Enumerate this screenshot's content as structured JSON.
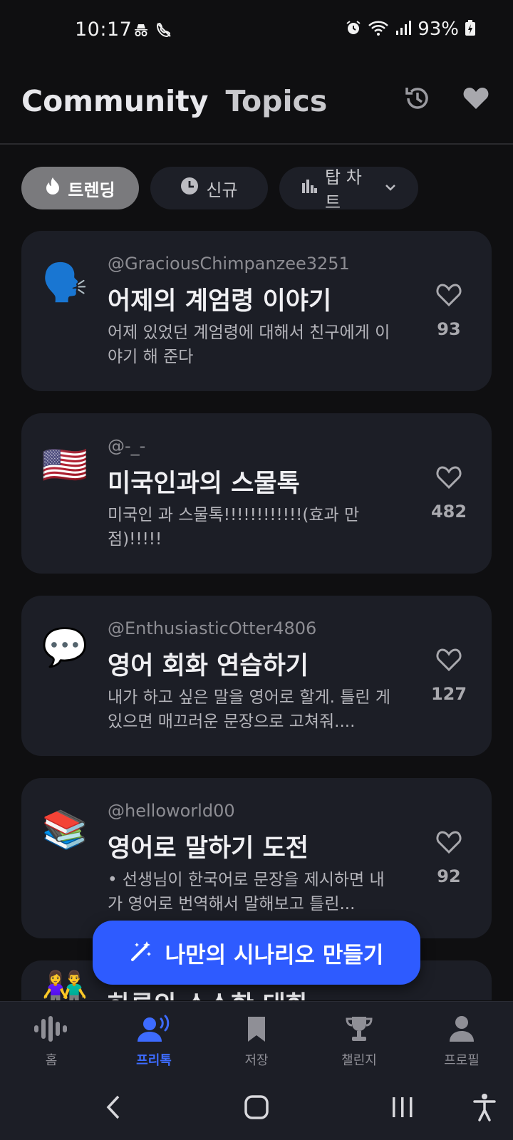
{
  "status_bar": {
    "time": "10:17",
    "battery": "93%",
    "icons": [
      "incognito-icon",
      "no-call-icon",
      "alarm-icon",
      "wifi-icon",
      "signal-icon",
      "battery-icon"
    ]
  },
  "header": {
    "tabs": [
      {
        "label": "Community",
        "active": true
      },
      {
        "label": "Topics",
        "active": false
      }
    ],
    "icons": [
      "history-icon",
      "heart-icon"
    ]
  },
  "filters": [
    {
      "label": "트렌딩",
      "icon": "fire-icon",
      "active": true
    },
    {
      "label": "신규",
      "icon": "clock-icon",
      "active": false
    },
    {
      "label": "탑 차트",
      "icon": "bar-chart-icon",
      "active": false
    }
  ],
  "topics": [
    {
      "emoji": "🗣️",
      "author": "@GraciousChimpanzee3251",
      "title": "어제의 계엄령 이야기",
      "description": "어제 있었던 계엄령에 대해서 친구에게 이야기 해 준다",
      "likes": "93"
    },
    {
      "emoji": "🇺🇸",
      "author": "@-_-",
      "title": "미국인과의 스물톡",
      "description": "미국인 과 스물톡!!!!!!!!!!!!(효과 만점)!!!!!",
      "likes": "482"
    },
    {
      "emoji": "💬",
      "author": "@EnthusiasticOtter4806",
      "title": "영어 회화 연습하기",
      "description": "내가 하고 싶은 말을 영어로 할게. 틀린 게 있으면 매끄러운 문장으로 고쳐줘....",
      "likes": "127"
    },
    {
      "emoji": "📚",
      "author": "@helloworld00",
      "title": "영어로 말하기 도전",
      "description": "• 선생님이 한국어로 문장을 제시하면 내가 영어로 번역해서 말해보고 틀린...",
      "likes": "92"
    },
    {
      "emoji": "👫",
      "author": "",
      "title": "하루의 소소한 대화",
      "description": "",
      "likes": ""
    }
  ],
  "fab": {
    "label": "나만의 시나리오 만들기",
    "icon": "magic-wand-icon"
  },
  "bottom_nav": [
    {
      "label": "홈",
      "icon": "waveform-icon",
      "active": false
    },
    {
      "label": "프리톡",
      "icon": "voice-user-icon",
      "active": true
    },
    {
      "label": "저장",
      "icon": "bookmark-icon",
      "active": false
    },
    {
      "label": "챌린지",
      "icon": "trophy-icon",
      "active": false
    },
    {
      "label": "프로필",
      "icon": "user-icon",
      "active": false
    }
  ],
  "colors": {
    "background": "#0f0f11",
    "card": "#1c1e26",
    "accent": "#2e5bff",
    "nav_active": "#3d6bff",
    "chip_active": "#7a7a7d"
  }
}
